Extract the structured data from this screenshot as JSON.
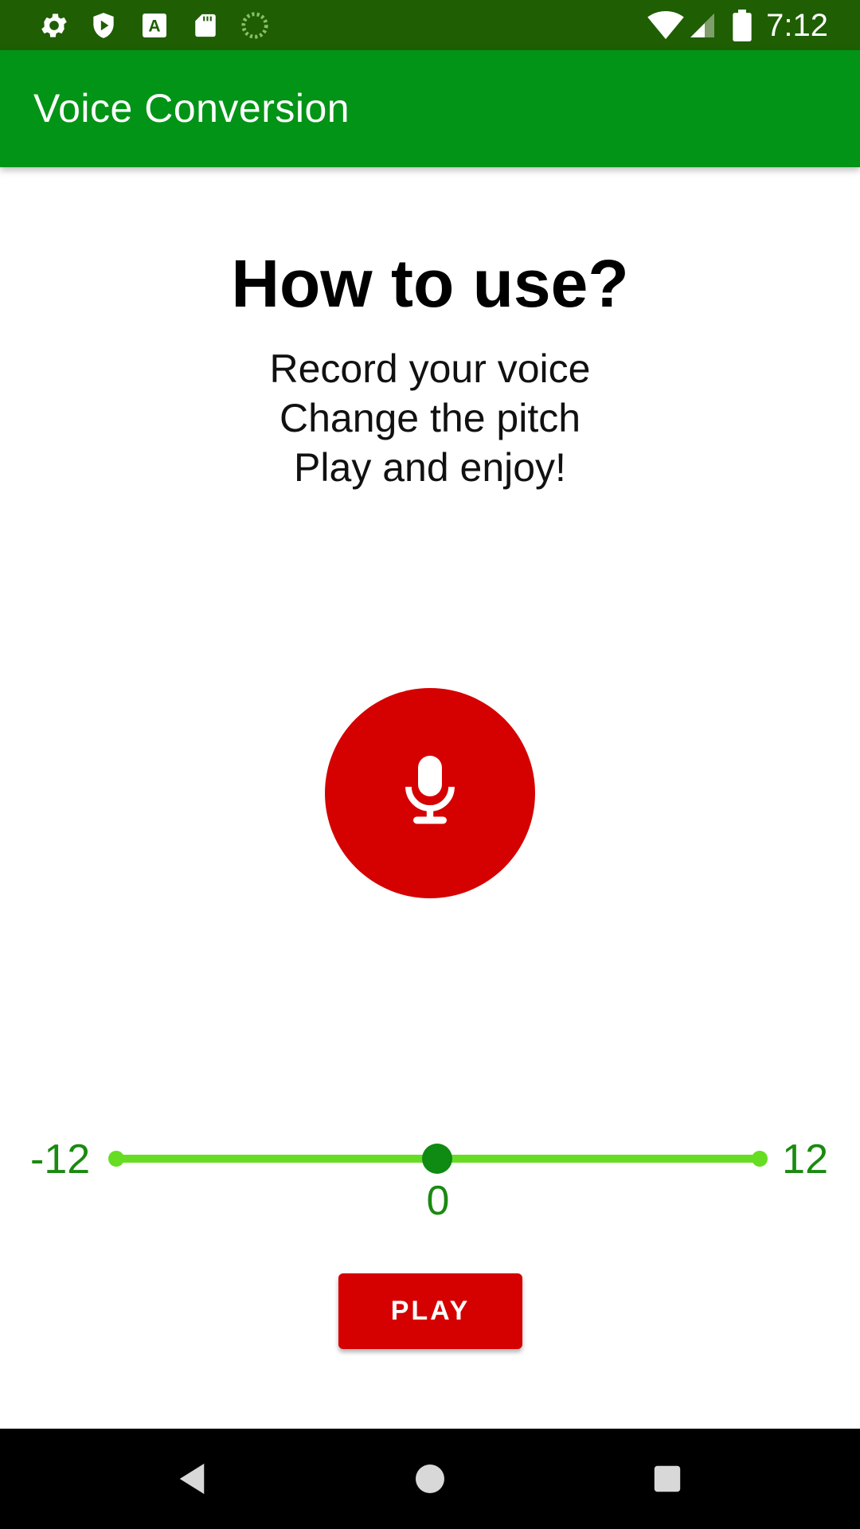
{
  "status_bar": {
    "time": "7:12",
    "left_icons": [
      "gear-icon",
      "shield-icon",
      "font-a-icon",
      "sd-card-icon",
      "loading-circle-icon"
    ],
    "right_icons": [
      "wifi-icon",
      "cell-signal-icon",
      "battery-icon"
    ]
  },
  "app_bar": {
    "title": "Voice Conversion"
  },
  "main": {
    "heading": "How to use?",
    "instructions": [
      "Record your voice",
      "Change the pitch",
      "Play and enjoy!"
    ],
    "record_button_icon": "microphone-icon"
  },
  "pitch_slider": {
    "min_label": "-12",
    "max_label": "12",
    "value_label": "0",
    "value": 0,
    "min": -12,
    "max": 12
  },
  "play_button": {
    "label": "PLAY"
  },
  "nav_bar": {
    "icons": [
      "back-icon",
      "home-icon",
      "recents-icon"
    ]
  },
  "colors": {
    "status_bar": "#1f5e02",
    "app_bar": "#029416",
    "accent_red": "#d50000",
    "slider_track": "#66dd22",
    "slider_thumb": "#0f8a12",
    "slider_text": "#1a8a10"
  }
}
